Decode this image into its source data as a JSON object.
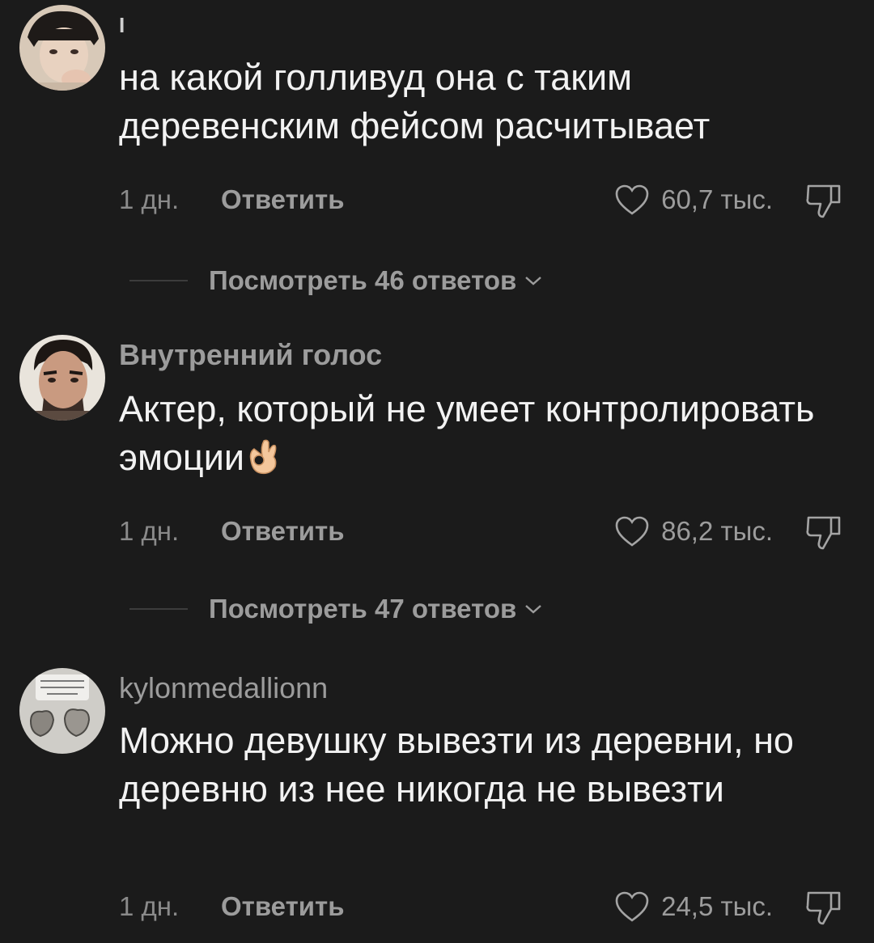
{
  "comments": [
    {
      "username": "I",
      "text": "на какой голливуд она с таким деревенским фейсом расчитывает",
      "time": "1 дн.",
      "reply_label": "Ответить",
      "likes": "60,7 тыс.",
      "view_replies": "Посмотреть 46 ответов"
    },
    {
      "username": "Внутренний голос",
      "text": "Актер, который не умеет контролировать эмоции",
      "emoji_icon": "ok-hand-emoji-icon",
      "time": "1 дн.",
      "reply_label": "Ответить",
      "likes": "86,2 тыс.",
      "view_replies": "Посмотреть 47 ответов"
    },
    {
      "username": "kylonmedallionn",
      "text": "Можно девушку вывезти из деревни, но деревню из нее никогда не вывезти",
      "time": "1 дн.",
      "reply_label": "Ответить",
      "likes": "24,5 тыс."
    }
  ],
  "icons": {
    "like": "heart-outline-icon",
    "dislike": "thumbs-down-icon",
    "expand": "chevron-down-icon"
  },
  "colors": {
    "background": "#1b1b1b",
    "text_primary": "#f2f2f2",
    "text_secondary": "#9c9c9c"
  }
}
